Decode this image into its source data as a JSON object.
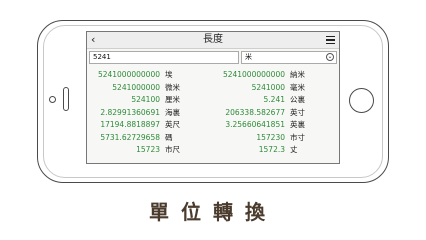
{
  "app": {
    "title": "長度",
    "back_icon": "chevron-left-icon",
    "menu_icon": "menu-icon"
  },
  "input": {
    "value": "5241",
    "unit": "米",
    "dropdown_icon": "chevron-down-icon"
  },
  "results": [
    {
      "left_value": "5241000000000",
      "left_unit": "埃",
      "right_value": "5241000000000",
      "right_unit": "納米"
    },
    {
      "left_value": "5241000000",
      "left_unit": "微米",
      "right_value": "5241000",
      "right_unit": "毫米"
    },
    {
      "left_value": "524100",
      "left_unit": "厘米",
      "right_value": "5.241",
      "right_unit": "公裏"
    },
    {
      "left_value": "2.82991360691",
      "left_unit": "海裏",
      "right_value": "206338.582677",
      "right_unit": "英寸"
    },
    {
      "left_value": "17194.8818897",
      "left_unit": "英尺",
      "right_value": "3.25660641851",
      "right_unit": "英裏"
    },
    {
      "left_value": "5731.62729658",
      "left_unit": "碼",
      "right_value": "157230",
      "right_unit": "市寸"
    },
    {
      "left_value": "15723",
      "left_unit": "市尺",
      "right_value": "1572.3",
      "right_unit": "丈"
    }
  ],
  "caption": "單位轉換",
  "colors": {
    "value_green": "#2e8b3a",
    "caption_brown": "#4b3b2d"
  }
}
